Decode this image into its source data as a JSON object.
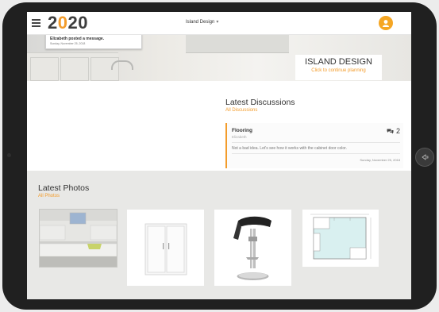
{
  "header": {
    "logo_prefix": "2",
    "logo_o": "0",
    "logo_mid": "2",
    "logo_o2": "0",
    "project_title": "Island Design",
    "caret": "▾"
  },
  "notification": {
    "title": "Elizabeth posted a message.",
    "date": "Sunday, November 25, 2018"
  },
  "banner": {
    "design_name": "ISLAND DESIGN",
    "design_link": "Click to continue planning"
  },
  "discussions": {
    "title": "Latest Discussions",
    "link": "All Discussions",
    "items": [
      {
        "topic": "Flooring",
        "author": "Elizabeth",
        "count": "2",
        "message": "Not a bad idea. Let's see how it works with the cabinet door color.",
        "date": "Sunday, November 25, 2018"
      }
    ]
  },
  "photos": {
    "title": "Latest Photos",
    "link": "All Photos"
  },
  "colors": {
    "accent": "#f39c2b",
    "text": "#333333"
  }
}
